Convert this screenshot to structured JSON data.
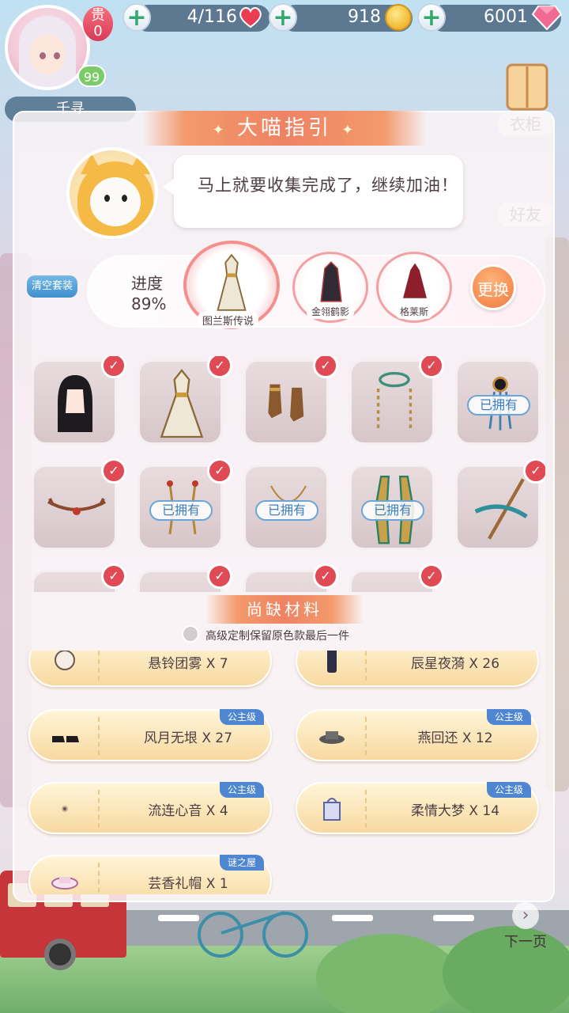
{
  "hud": {
    "player_name": "千寻",
    "vip_label": "贵",
    "vip_level": "0",
    "player_level": "99",
    "stamina": "4/116",
    "gold": "918",
    "diamonds": "6001",
    "plus_symbol": "+"
  },
  "side_menu": {
    "wardrobe": "衣柜",
    "friends": "好友"
  },
  "guide": {
    "title": "大喵指引",
    "sparkle_left": "✦",
    "sparkle_right": "✦",
    "message": "马上就要收集完成了，继续加油！",
    "clear_button": "清空套装",
    "progress_label": "进度",
    "progress_value": "89%",
    "progress_fraction": 0.89,
    "suits": [
      {
        "name": "图兰斯传说",
        "selected": true
      },
      {
        "name": "金翎鹤影",
        "selected": false
      },
      {
        "name": "格莱斯",
        "selected": false
      }
    ],
    "swap_button": "更换"
  },
  "items": {
    "check_symbol": "✓",
    "owned_label": "已拥有",
    "rows": [
      [
        {
          "icon": "hair-icon",
          "checked": true,
          "owned": false
        },
        {
          "icon": "dress-icon",
          "checked": true,
          "owned": false
        },
        {
          "icon": "shoes-icon",
          "checked": true,
          "owned": false
        },
        {
          "icon": "earrings-icon",
          "checked": true,
          "owned": false
        },
        {
          "icon": "headpiece-icon",
          "checked": false,
          "owned": true
        }
      ],
      [
        {
          "icon": "tiara-icon",
          "checked": true,
          "owned": false
        },
        {
          "icon": "hair-ornament-icon",
          "checked": true,
          "owned": true
        },
        {
          "icon": "necklace-icon",
          "checked": false,
          "owned": true
        },
        {
          "icon": "wings-icon",
          "checked": false,
          "owned": true
        },
        {
          "icon": "staff-icon",
          "checked": true,
          "owned": false
        }
      ],
      [
        {
          "icon": "accessory-icon",
          "checked": true,
          "owned": false
        },
        {
          "icon": "accessory-icon",
          "checked": true,
          "owned": false
        },
        {
          "icon": "accessory-icon",
          "checked": true,
          "owned": false
        },
        {
          "icon": "accessory-icon",
          "checked": true,
          "owned": false
        }
      ]
    ]
  },
  "missing": {
    "title": "尚缺材料",
    "option_label": "高级定制保留原色款最后一件",
    "materials": [
      {
        "name": "悬铃团雾 X 7",
        "tag": "",
        "icon": "hair-bun-icon"
      },
      {
        "name": "辰星夜漪 X 26",
        "tag": "",
        "icon": "boots-icon"
      },
      {
        "name": "风月无垠 X 27",
        "tag": "公主级",
        "icon": "shoes-icon"
      },
      {
        "name": "燕回还 X 12",
        "tag": "公主级",
        "icon": "hat-icon"
      },
      {
        "name": "流连心音 X 4",
        "tag": "公主级",
        "icon": "earring-icon"
      },
      {
        "name": "柔情大梦 X 14",
        "tag": "公主级",
        "icon": "bag-icon"
      },
      {
        "name": "芸香礼帽 X 1",
        "tag": "谜之屋",
        "icon": "hat-icon"
      }
    ]
  },
  "footer": {
    "next_arrow": "›",
    "next_label": "下一页"
  },
  "colors": {
    "accent_orange": "#ee8363",
    "check_red": "#e04a55",
    "owned_blue": "#3b7fc0",
    "tag_blue": "#4f86d2"
  }
}
